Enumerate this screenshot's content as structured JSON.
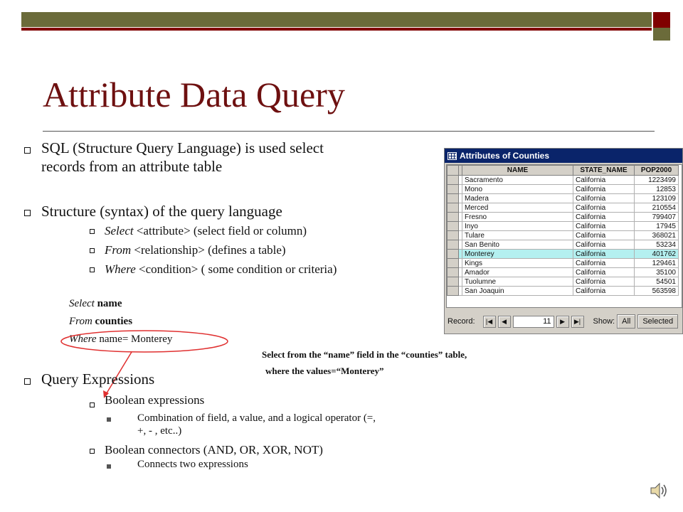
{
  "slide": {
    "title": "Attribute Data Query",
    "bullets": {
      "b1_line1": "SQL (Structure Query Language) is used select",
      "b1_line2": "records from an attribute table",
      "b2": "Structure (syntax) of the query language",
      "sub1_kw": "Select",
      "sub1_rest": " <attribute>   (select field or column)",
      "sub2_kw": "From",
      "sub2_rest": " <relationship>  (defines a table)",
      "sub3_kw": "Where",
      "sub3_rest": " <condition>   ( some condition or criteria)",
      "ex1_kw": "Select",
      "ex1_val": " name",
      "ex2_kw": "From",
      "ex2_val": " counties",
      "ex3_kw": "Where",
      "ex3_val": " name= Monterey",
      "b3": "Query Expressions",
      "b3_sub1": "Boolean expressions",
      "b3_sub1_item_line1": "Combination of field, a value, and a logical operator (=,",
      "b3_sub1_item_line2": "+, - , etc..)",
      "b3_sub2": "Boolean connectors (AND, OR, XOR, NOT)",
      "b3_sub2_item": "Connects two expressions"
    },
    "caption_line1": "Select from the “name” field in the “counties” table,",
    "caption_line2": "where the values=“Monterey”"
  },
  "window": {
    "title": "Attributes of Counties",
    "columns": [
      "NAME",
      "STATE_NAME",
      "POP2000"
    ],
    "rows": [
      [
        "Sacramento",
        "California",
        "1223499"
      ],
      [
        "Mono",
        "California",
        "12853"
      ],
      [
        "Madera",
        "California",
        "123109"
      ],
      [
        "Merced",
        "California",
        "210554"
      ],
      [
        "Fresno",
        "California",
        "799407"
      ],
      [
        "Inyo",
        "California",
        "17945"
      ],
      [
        "Tulare",
        "California",
        "368021"
      ],
      [
        "San Benito",
        "California",
        "53234"
      ],
      [
        "Monterey",
        "California",
        "401762"
      ],
      [
        "Kings",
        "California",
        "129461"
      ],
      [
        "Amador",
        "California",
        "35100"
      ],
      [
        "Tuolumne",
        "California",
        "54501"
      ],
      [
        "San Joaquin",
        "California",
        "563598"
      ]
    ],
    "highlighted_row": 8,
    "record_label": "Record:",
    "record_value": "11",
    "show_label": "Show:",
    "all_label": "All",
    "selected_label": "Selected"
  },
  "colors": {
    "title": "#6e1010",
    "band_olive": "#6b6b3a",
    "band_red": "#800000",
    "highlight": "#b4f0f0",
    "annotation": "#e03030"
  }
}
